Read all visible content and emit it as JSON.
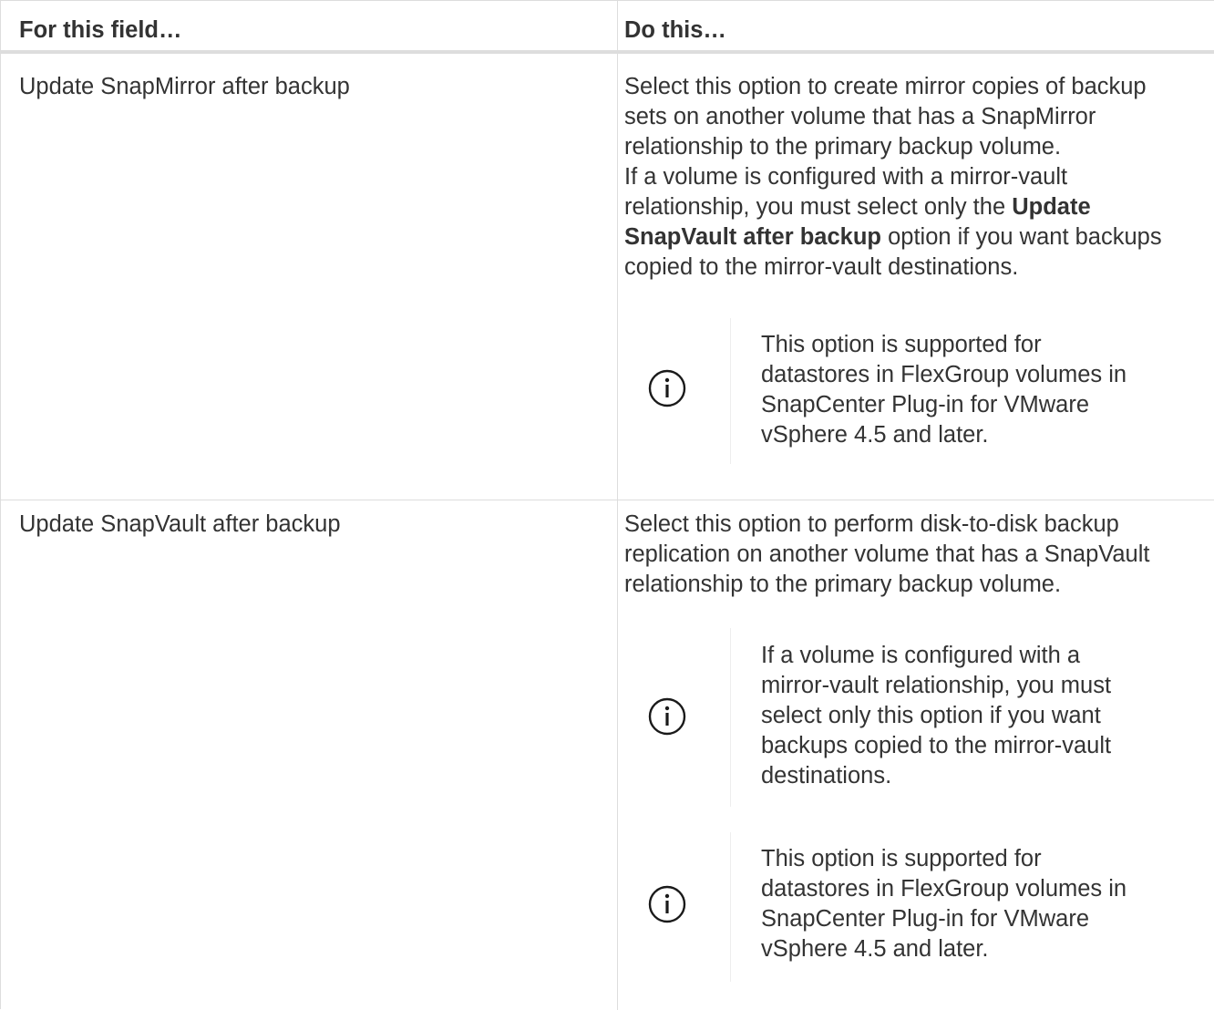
{
  "table": {
    "headers": {
      "field": "For this field…",
      "action": "Do this…"
    },
    "rows": [
      {
        "field": "Update SnapMirror after backup",
        "description": {
          "lines": [
            "Select this option to create mirror copies of backup",
            "sets on another volume that has a SnapMirror",
            "relationship to the primary backup volume.",
            "If a volume is configured with a mirror-vault"
          ],
          "line5_before": "relationship, you must select only the ",
          "line5_bold": "Update",
          "line6_bold": "SnapVault after backup",
          "line6_after": " option if you want backups",
          "line7": "copied to the mirror-vault destinations."
        },
        "notes": [
          {
            "icon": "info-icon",
            "lines": [
              "This option is supported for",
              "datastores in FlexGroup volumes in",
              "SnapCenter Plug-in for VMware",
              "vSphere 4.5 and later."
            ]
          }
        ]
      },
      {
        "field": "Update SnapVault after backup",
        "description": {
          "lines": [
            "Select this option to perform disk-to-disk backup",
            "replication on another volume that has a SnapVault",
            "relationship to the primary backup volume."
          ]
        },
        "notes": [
          {
            "icon": "info-icon",
            "lines": [
              "If a volume is configured with a",
              "mirror-vault relationship, you must",
              "select only this option if you want",
              "backups copied to the mirror-vault",
              "destinations."
            ]
          },
          {
            "icon": "info-icon",
            "lines": [
              "This option is supported for",
              "datastores in FlexGroup volumes in",
              "SnapCenter Plug-in for VMware",
              "vSphere 4.5 and later."
            ]
          }
        ]
      }
    ]
  },
  "colors": {
    "text": "#333333",
    "border": "#dddddd",
    "note_rule": "#eeeeee",
    "icon": "#1a1a1a"
  }
}
